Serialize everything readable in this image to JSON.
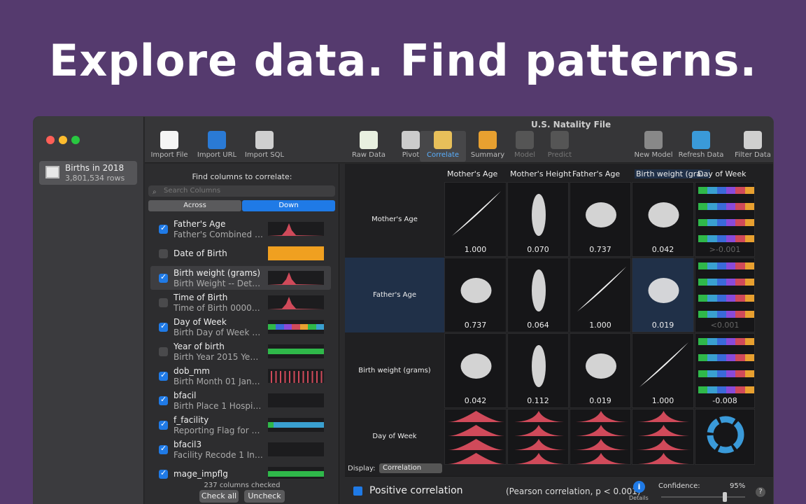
{
  "hero": {
    "headline": "Explore data. Find patterns."
  },
  "window": {
    "title": "U.S. Natality File"
  },
  "sidebar": {
    "source_name": "Births in 2018",
    "source_rows": "3,801,534 rows"
  },
  "toolbar": [
    {
      "label": "Import File",
      "icon": "import-file-icon",
      "color": "#f5f5f5"
    },
    {
      "label": "Import URL",
      "icon": "globe-icon",
      "color": "#2a7ad5"
    },
    {
      "label": "Import SQL",
      "icon": "database-icon",
      "color": "#cfcfcf"
    },
    {
      "label": "Raw Data",
      "icon": "table-icon",
      "color": "#e8f0e0"
    },
    {
      "label": "Pivot",
      "icon": "calculator-icon",
      "color": "#cccccc"
    },
    {
      "label": "Correlate",
      "icon": "pencil-icon",
      "color": "#e8c05a"
    },
    {
      "label": "Summary",
      "icon": "pie-chart-icon",
      "color": "#e8a030"
    },
    {
      "label": "Model",
      "icon": "hammer-icon",
      "color": "#555"
    },
    {
      "label": "Predict",
      "icon": "lightbulb-icon",
      "color": "#555"
    },
    {
      "label": "New Model",
      "icon": "new-model-icon",
      "color": "#888"
    },
    {
      "label": "Refresh Data",
      "icon": "refresh-icon",
      "color": "#3a9ad9"
    },
    {
      "label": "Filter Data",
      "icon": "funnel-icon",
      "color": "#cfcfcf"
    }
  ],
  "left": {
    "find_label": "Find columns to correlate:",
    "search_placeholder": "Search Columns",
    "seg_across": "Across",
    "seg_down": "Down",
    "columns": [
      {
        "name": "Father's Age",
        "desc": "Father's Combined A...",
        "checked": true
      },
      {
        "name": "Date of Birth",
        "desc": "",
        "checked": false
      },
      {
        "name": "Birth weight (grams)",
        "desc": "Birth Weight -- Detail...",
        "checked": true
      },
      {
        "name": "Time of Birth",
        "desc": "Time of Birth 0000-2...",
        "checked": false
      },
      {
        "name": "Day of Week",
        "desc": "Birth Day of Week 1 S...",
        "checked": true
      },
      {
        "name": "Year of birth",
        "desc": "Birth Year 2015 Year...",
        "checked": false
      },
      {
        "name": "dob_mm",
        "desc": "Birth Month 01 January",
        "checked": true
      },
      {
        "name": "bfacil",
        "desc": "Birth Place 1 Hospital",
        "checked": true
      },
      {
        "name": "f_facility",
        "desc": "Reporting Flag for Birt...",
        "checked": true
      },
      {
        "name": "bfacil3",
        "desc": "Facility Recode 1 In H...",
        "checked": true
      },
      {
        "name": "mage_impflg",
        "desc": "",
        "checked": true
      }
    ],
    "count_text": "237 columns checked",
    "check_all": "Check all",
    "uncheck": "Uncheck"
  },
  "matrix": {
    "col_headers": [
      "Mother's Age",
      "Mother's Height",
      "Father's Age",
      "Birth weight (gra...",
      "Day of Week"
    ],
    "row_labels": [
      "Mother's Age",
      "Father's Age",
      "Birth weight (grams)",
      "Day of Week"
    ],
    "values": [
      [
        "1.000",
        "0.070",
        "0.737",
        "0.042",
        ">-0.001"
      ],
      [
        "0.737",
        "0.064",
        "1.000",
        "0.019",
        "<0.001"
      ],
      [
        "0.042",
        "0.112",
        "0.019",
        "1.000",
        "-0.008"
      ]
    ],
    "display_label": "Display:",
    "display_value": "Correlation"
  },
  "bottom": {
    "legend": "Positive correlation",
    "pearson": "(Pearson correlation, p < 0.001)",
    "details": "Details",
    "confidence_label": "Confidence:",
    "confidence_value": "95%"
  },
  "colors": {
    "accent": "#1f7ae6",
    "histogram": "#d04a5a",
    "dob_bar": "#f0a020",
    "green_bar": "#2fb84a"
  }
}
